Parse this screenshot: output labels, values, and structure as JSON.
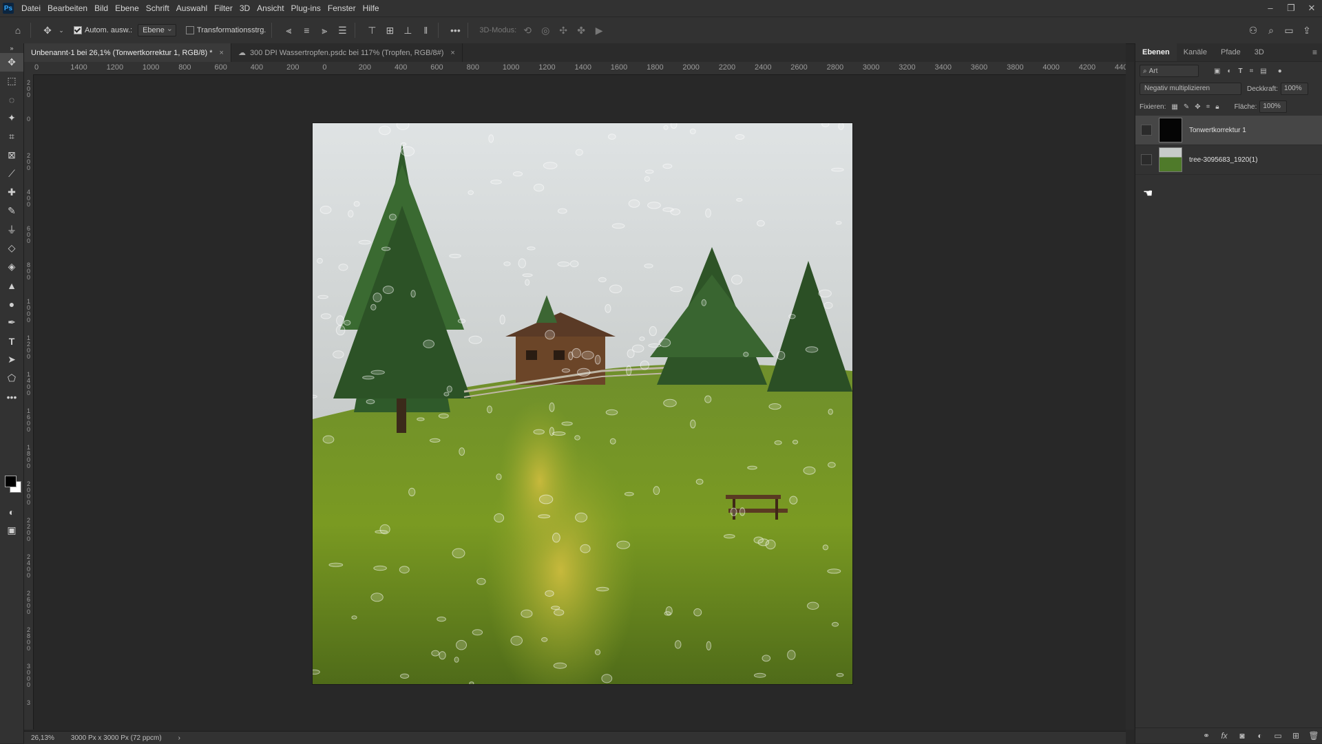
{
  "app": {
    "logo": "Ps"
  },
  "menu": [
    "Datei",
    "Bearbeiten",
    "Bild",
    "Ebene",
    "Schrift",
    "Auswahl",
    "Filter",
    "3D",
    "Ansicht",
    "Plug-ins",
    "Fenster",
    "Hilfe"
  ],
  "options": {
    "auto_select_label": "Autom. ausw.:",
    "auto_select_value": "Ebene",
    "transform_label": "Transformationsstrg.",
    "mode_3d_label": "3D-Modus:"
  },
  "tabs": [
    {
      "label": "Unbenannt-1 bei 26,1% (Tonwertkorrektur 1, RGB/8) *",
      "close": "×"
    },
    {
      "label": "300 DPI Wassertropfen.psdc bei 117% (Tropfen, RGB/8#)",
      "close": "×"
    }
  ],
  "ruler_h": [
    "0",
    "1400",
    "1200",
    "1000",
    "800",
    "600",
    "400",
    "200",
    "0",
    "200",
    "400",
    "600",
    "800",
    "1000",
    "1200",
    "1400",
    "1600",
    "1800",
    "2000",
    "2200",
    "2400",
    "2600",
    "2800",
    "3000",
    "3200",
    "3400",
    "3600",
    "3800",
    "4000",
    "4200",
    "4400"
  ],
  "ruler_v": [
    "200",
    "0",
    "200",
    "400",
    "600",
    "800",
    "1000",
    "1200",
    "1400",
    "1600",
    "1800",
    "2000",
    "2200",
    "2400",
    "2600",
    "2800",
    "3000",
    "3"
  ],
  "status": {
    "zoom": "26,13%",
    "doc_info": "3000 Px x 3000 Px (72 ppcm)",
    "arrow": "›"
  },
  "layers_panel": {
    "tabs": [
      "Ebenen",
      "Kanäle",
      "Pfade",
      "3D"
    ],
    "filter_placeholder": "Art",
    "blend_mode": "Negativ multiplizieren",
    "opacity_label": "Deckkraft:",
    "opacity_value": "100%",
    "lock_label": "Fixieren:",
    "fill_label": "Fläche:",
    "fill_value": "100%",
    "layers": [
      {
        "name": "Tonwertkorrektur 1",
        "selected": true
      },
      {
        "name": "tree-3095683_1920(1)",
        "selected": false
      }
    ]
  },
  "colors": {
    "accent": "#31a8ff",
    "ui_bg": "#323232",
    "canvas_bg": "#282828"
  }
}
